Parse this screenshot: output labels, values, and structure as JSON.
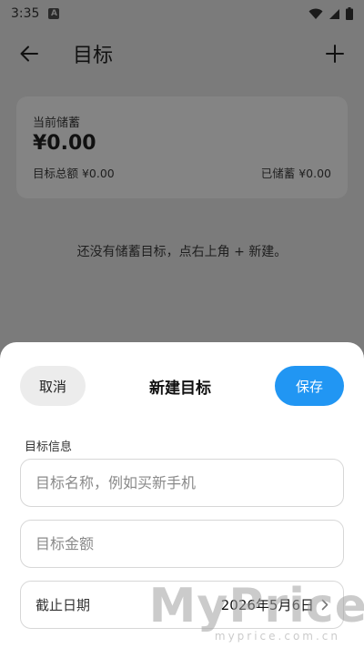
{
  "status_bar": {
    "time": "3:35",
    "notif_icon": "A"
  },
  "app_bar": {
    "title": "目标"
  },
  "summary": {
    "label": "当前储蓄",
    "amount": "¥0.00",
    "total_label": "目标总额 ¥0.00",
    "saved_label": "已储蓄 ¥0.00"
  },
  "empty_message": "还没有储蓄目标，点右上角 + 新建。",
  "sheet": {
    "cancel_label": "取消",
    "title": "新建目标",
    "save_label": "保存",
    "section_label": "目标信息",
    "name_placeholder": "目标名称，例如买新手机",
    "amount_placeholder": "目标金额",
    "date_label": "截止日期",
    "date_value": "2026年5月6日"
  },
  "watermark": {
    "big": "MyPrice",
    "small": "myprice.com.cn"
  },
  "colors": {
    "accent": "#2196f3",
    "scrim": "#7b7b7b",
    "sheet_bg": "#ffffff"
  }
}
